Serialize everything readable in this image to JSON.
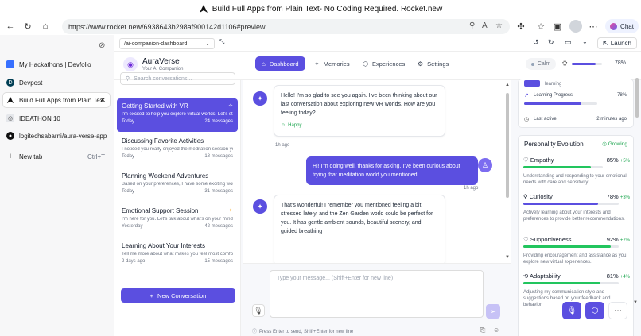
{
  "window": {
    "title": "Build Full Apps from Plain Text- No Coding Required. Rocket.new"
  },
  "address": {
    "url": "https://www.rocket.new/6938643b298af900142d1106#preview"
  },
  "browser": {
    "chat_label": "Chat",
    "launch_label": "Launch",
    "project_select": "/ai-companion-dashboard"
  },
  "tabs": [
    {
      "label": "My Hackathons | Devfolio",
      "color": "#3770ff"
    },
    {
      "label": "Devpost",
      "color": "#003e54"
    },
    {
      "label": "Build Full Apps from Plain Tex",
      "color": "#111111"
    },
    {
      "label": "IDEATHON 10",
      "color": "#6b7280"
    },
    {
      "label": "logitechsabarni/aura-verse-app",
      "color": "#111111"
    }
  ],
  "new_tab": {
    "label": "New tab",
    "shortcut": "Ctrl+T"
  },
  "brand": {
    "name": "AuraVerse",
    "tagline": "Your AI Companion"
  },
  "nav": [
    "Dashboard",
    "Memories",
    "Experiences",
    "Settings"
  ],
  "status": {
    "mood": "Calm",
    "percent": "78%",
    "level": 0.78
  },
  "search": {
    "placeholder": "Search conversations..."
  },
  "conversations": [
    {
      "title": "Getting Started with VR",
      "preview": "I'm excited to help you explore virtual worlds! Let's st...",
      "time": "Today",
      "count": "24 messages"
    },
    {
      "title": "Discussing Favorite Activities",
      "preview": "I noticed you really enjoyed the meditation session ye...",
      "time": "Today",
      "count": "18 messages"
    },
    {
      "title": "Planning Weekend Adventures",
      "preview": "Based on your preferences, I have some exciting worl...",
      "time": "Today",
      "count": "31 messages"
    },
    {
      "title": "Emotional Support Session",
      "preview": "I'm here for you. Let's talk about what's on your mind ...",
      "time": "Yesterday",
      "count": "42 messages"
    },
    {
      "title": "Learning About Your Interests",
      "preview": "Tell me more about what makes you feel most comfor...",
      "time": "2 days ago",
      "count": "15 messages"
    }
  ],
  "new_conversation": "New Conversation",
  "messages": {
    "m1": "Hello! I'm so glad to see you again. I've been thinking about our last conversation about exploring new VR worlds. How are you feeling today?",
    "m1_mood": "Happy",
    "m1_time": "1h ago",
    "m2": "Hi! I'm doing well, thanks for asking. I've been curious about trying that meditation world you mentioned.",
    "m2_time": "1h ago",
    "m3": "That's wonderful! I remember you mentioned feeling a bit stressed lately, and the Zen Garden world could be perfect for you. It has gentle ambient sounds, beautiful scenery, and guided breathing"
  },
  "composer": {
    "placeholder": "Type your message... (Shift+Enter for new line)",
    "hint": "Press Enter to send, Shift+Enter for new line"
  },
  "stats": {
    "learning_word": "learning",
    "progress_label": "Learning Progress",
    "progress_value": "78%",
    "progress_level": 0.78,
    "last_active_label": "Last active",
    "last_active_value": "2 minutes ago"
  },
  "evolution": {
    "title": "Personality Evolution",
    "badge": "Growing",
    "traits": [
      {
        "name": "Empathy",
        "value": "85%",
        "delta": "+5%",
        "level": 0.85,
        "color": "#22c55e",
        "desc": "Understanding and responding to your emotional needs with care and sensitivity."
      },
      {
        "name": "Curiosity",
        "value": "78%",
        "delta": "+3%",
        "level": 0.78,
        "color": "#5b4fe0",
        "desc": "Actively learning about your interests and preferences to provide better recommendations."
      },
      {
        "name": "Supportiveness",
        "value": "92%",
        "delta": "+7%",
        "level": 0.92,
        "color": "#22c55e",
        "desc": "Providing encouragement and assistance as you explore new virtual experiences."
      },
      {
        "name": "Adaptability",
        "value": "81%",
        "delta": "+4%",
        "level": 0.81,
        "color": "#22c55e",
        "desc": "Adjusting my communication style and suggestions based on your feedback and behavior."
      }
    ]
  }
}
